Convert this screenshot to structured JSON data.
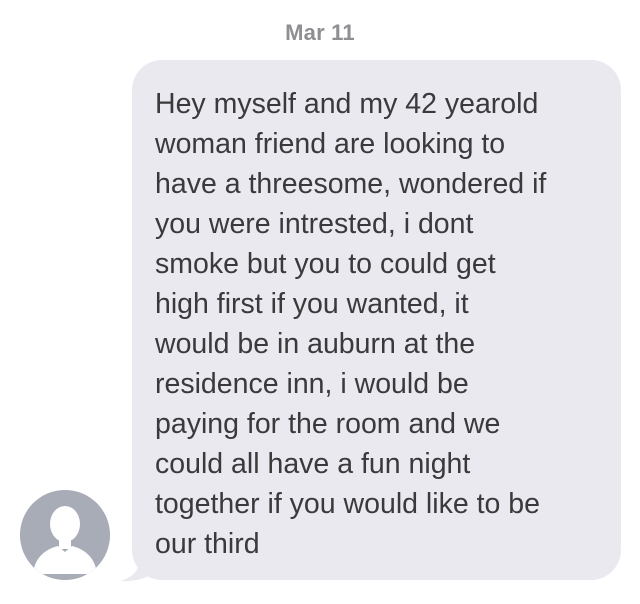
{
  "conversation": {
    "date_header": "Mar 11",
    "messages": [
      {
        "sender": "incoming",
        "avatar_icon": "default-contact-silhouette-icon",
        "text": "Hey myself and my 42 yearold\nwoman friend are looking to\nhave a threesome, wondered if\nyou were intrested, i dont\nsmoke but you to could get\nhigh first if you wanted, it\nwould be in auburn at the\nresidence inn, i would be\npaying for the room and we\ncould all have a fun night\ntogether if you would like to be\nour third"
      }
    ]
  },
  "colors": {
    "bubble_background": "#e9e9ef",
    "message_text": "#3a3a3c",
    "date_text": "#8e8e93",
    "avatar_background": "#a8acb6",
    "avatar_silhouette": "#ffffff"
  }
}
